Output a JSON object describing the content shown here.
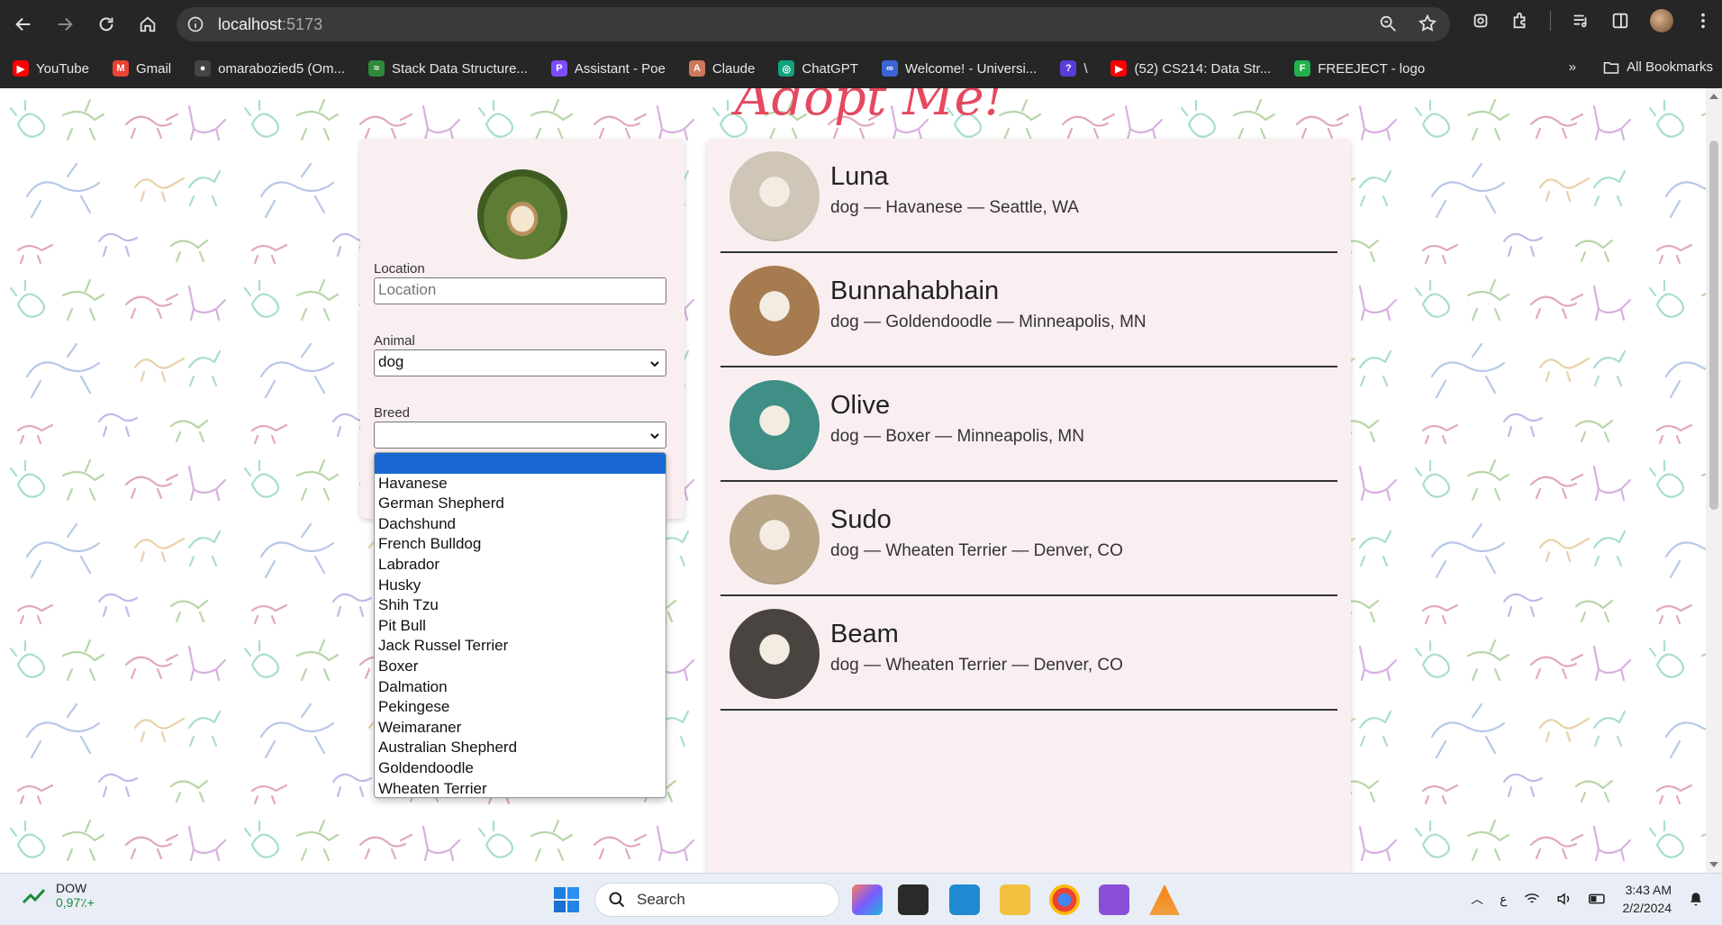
{
  "browser": {
    "url_host": "localhost",
    "url_port": ":5173",
    "bookmarks": [
      {
        "label": "YouTube",
        "color": "#ff0000",
        "glyph": "▶"
      },
      {
        "label": "Gmail",
        "color": "#ea4335",
        "glyph": "M"
      },
      {
        "label": "omarabozied5 (Om...",
        "color": "#444444",
        "glyph": "●"
      },
      {
        "label": "Stack Data Structure...",
        "color": "#2f8a3a",
        "glyph": "≈"
      },
      {
        "label": "Assistant - Poe",
        "color": "#7b4dff",
        "glyph": "P"
      },
      {
        "label": "Claude",
        "color": "#cc785c",
        "glyph": "A"
      },
      {
        "label": "ChatGPT",
        "color": "#10a37f",
        "glyph": "◎"
      },
      {
        "label": "Welcome! - Universi...",
        "color": "#3c64d8",
        "glyph": "∞"
      },
      {
        "label": "\\",
        "color": "#5b3cd8",
        "glyph": "?"
      },
      {
        "label": "(52) CS214: Data Str...",
        "color": "#ff0000",
        "glyph": "▶"
      },
      {
        "label": "FREEJECT - logo",
        "color": "#22b14c",
        "glyph": "F"
      }
    ],
    "all_bookmarks_label": "All Bookmarks"
  },
  "page": {
    "logo_text": "Adopt Me!",
    "form": {
      "location_label": "Location",
      "location_placeholder": "Location",
      "animal_label": "Animal",
      "animal_value": "dog",
      "breed_label": "Breed",
      "breed_value": ""
    },
    "breed_options": [
      "",
      "Havanese",
      "German Shepherd",
      "Dachshund",
      "French Bulldog",
      "Labrador",
      "Husky",
      "Shih Tzu",
      "Pit Bull",
      "Jack Russel Terrier",
      "Boxer",
      "Dalmation",
      "Pekingese",
      "Weimaraner",
      "Australian Shepherd",
      "Goldendoodle",
      "Wheaten Terrier"
    ],
    "pets": [
      {
        "name": "Luna",
        "meta": "dog — Havanese — Seattle, WA",
        "photo_color": "#cfc6b8"
      },
      {
        "name": "Bunnahabhain",
        "meta": "dog — Goldendoodle — Minneapolis, MN",
        "photo_color": "#a67b4f"
      },
      {
        "name": "Olive",
        "meta": "dog — Boxer — Minneapolis, MN",
        "photo_color": "#3f8f86"
      },
      {
        "name": "Sudo",
        "meta": "dog — Wheaten Terrier — Denver, CO",
        "photo_color": "#b8a486"
      },
      {
        "name": "Beam",
        "meta": "dog — Wheaten Terrier — Denver, CO",
        "photo_color": "#4a4440"
      }
    ]
  },
  "taskbar": {
    "stock_name": "DOW",
    "stock_change": "0,97٪+",
    "search_label": "Search",
    "keyboard_lang": "ع",
    "time": "3:43 AM",
    "date": "2/2/2024"
  }
}
